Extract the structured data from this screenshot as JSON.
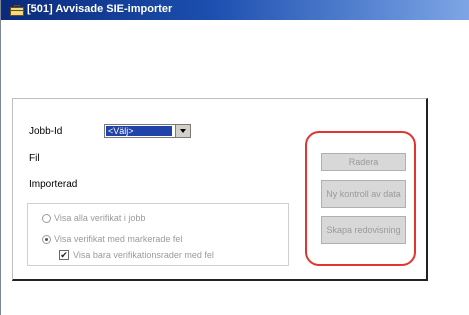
{
  "window": {
    "title": "[501] Avvisade SIE-importer"
  },
  "form": {
    "jobb_id_label": "Jobb-Id",
    "jobb_id_value": "<Välj>",
    "fil_label": "Fil",
    "importerad_label": "Importerad"
  },
  "options": {
    "radio_all": "Visa alla verifikat i jobb",
    "radio_marked": "Visa verifikat med markerade fel",
    "checkbox_rows": "Visa bara verifikationsrader med fel",
    "selected_radio": "radio_marked",
    "checkbox_checked": true
  },
  "buttons": {
    "radera": "Radera",
    "ny_kontroll": "Ny kontroll av data",
    "skapa": "Skapa redovisning"
  },
  "colors": {
    "titlebar_start": "#0a2a7a",
    "titlebar_end": "#7ea6e6",
    "highlight": "#e3342f",
    "selection": "#1f43a8"
  },
  "icons": {
    "app_icon": "briefcase-icon",
    "dropdown": "chevron-down-icon",
    "check": "checkmark-icon"
  }
}
